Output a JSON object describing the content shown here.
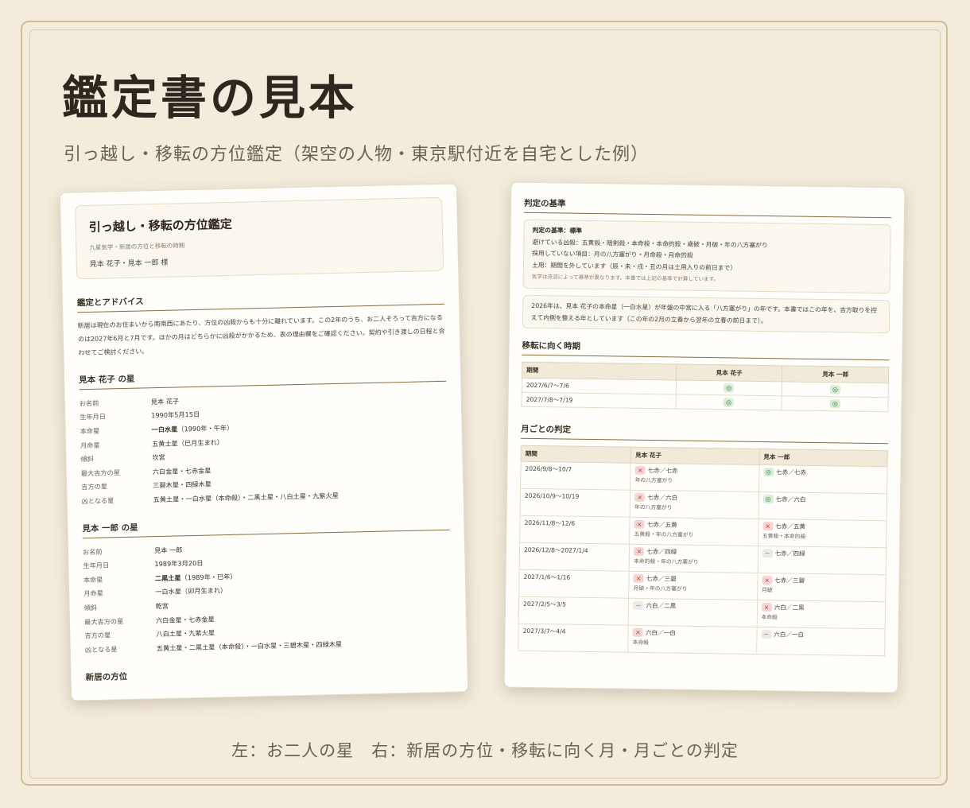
{
  "header": {
    "title": "鑑定書の見本",
    "subtitle": "引っ越し・移転の方位鑑定（架空の人物・東京駅付近を自宅とした例）"
  },
  "caption": "左：お二人の星　右：新居の方位・移転に向く月・月ごとの判定",
  "left_page": {
    "title": "引っ越し・移転の方位鑑定",
    "subtitle": "九星気学・新居の方位と移転の時期",
    "names": "見本 花子・見本 一郎 様",
    "advice_heading": "鑑定とアドバイス",
    "advice_text": "新居は現在のお住まいから南南西にあたり、方位の凶殺からも十分に離れています。この2年のうち、お二人そろって吉方になるのは2027年6月と7月です。ほかの月はどちらかに凶殺がかかるため、表の理由欄をご確認ください。契約や引き渡しの日程と合わせてご検討ください。",
    "hanako": {
      "heading": "見本 花子 の星",
      "rows": [
        {
          "label": "お名前",
          "value": "見本 花子"
        },
        {
          "label": "生年月日",
          "value": "1990年5月15日"
        },
        {
          "label": "本命星",
          "value": "一白水星",
          "extra": "（1990年・午年）"
        },
        {
          "label": "月命星",
          "value": "五黄土星（巳月生まれ）"
        },
        {
          "label": "傾斜",
          "value": "坎宮"
        },
        {
          "label": "最大吉方の星",
          "value": "六白金星・七赤金星"
        },
        {
          "label": "吉方の星",
          "value": "三碧木星・四緑木星"
        },
        {
          "label": "凶となる星",
          "value": "五黄土星・一白水星（本命殺）・二黒土星・八白土星・九紫火星"
        }
      ]
    },
    "ichiro": {
      "heading": "見本 一郎 の星",
      "rows": [
        {
          "label": "お名前",
          "value": "見本 一郎"
        },
        {
          "label": "生年月日",
          "value": "1989年3月20日"
        },
        {
          "label": "本命星",
          "value": "二黒土星",
          "extra": "（1989年・巳年）"
        },
        {
          "label": "月命星",
          "value": "一白水星（卯月生まれ）"
        },
        {
          "label": "傾斜",
          "value": "乾宮"
        },
        {
          "label": "最大吉方の星",
          "value": "六白金星・七赤金星"
        },
        {
          "label": "吉方の星",
          "value": "八白土星・九紫火星"
        },
        {
          "label": "凶となる星",
          "value": "五黄土星・二黒土星（本命殺）・一白水星・三碧木星・四緑木星"
        }
      ]
    },
    "next_heading": "新居の方位"
  },
  "right_page": {
    "basis_heading": "判定の基準",
    "basis_title": "判定の基準：標準",
    "basis_lines": [
      "避けている凶殺：五黄殺・暗剣殺・本命殺・本命的殺・歳破・月破・年の八方塞がり",
      "採用していない項目：月の八方塞がり・月命殺・月命的殺",
      "土用：期間を外しています（辰・未・戌・丑の月は土用入りの前日まで）"
    ],
    "basis_note": "気学は流派によって基準が異なります。本書では上記の基準で計算しています。",
    "year_note": "2026年は、見本 花子の本命星（一白水星）が年盤の中宮に入る「八方塞がり」の年です。本書ではこの年を、吉方取りを控えて内側を整える年としています（この年の2月の立春から翌年の立春の前日まで）。",
    "timing_heading": "移転に向く時期",
    "timing_headers": [
      "期間",
      "見本 花子",
      "見本 一郎"
    ],
    "timing_rows": [
      {
        "period": "2027/6/7〜7/6",
        "a": "◎",
        "b": "◎"
      },
      {
        "period": "2027/7/8〜7/19",
        "a": "◎",
        "b": "◎"
      }
    ],
    "monthly_heading": "月ごとの判定",
    "monthly_headers": [
      "期間",
      "見本 花子",
      "見本 一郎"
    ],
    "monthly_rows": [
      {
        "period": "2026/9/8〜10/7",
        "a_mark": "×",
        "a_stars": "七赤／七赤",
        "a_note": "年の八方塞がり",
        "b_mark": "◎",
        "b_stars": "七赤／七赤",
        "b_note": ""
      },
      {
        "period": "2026/10/9〜10/19",
        "a_mark": "×",
        "a_stars": "七赤／六白",
        "a_note": "年の八方塞がり",
        "b_mark": "◎",
        "b_stars": "七赤／六白",
        "b_note": ""
      },
      {
        "period": "2026/11/8〜12/6",
        "a_mark": "×",
        "a_stars": "七赤／五黄",
        "a_note": "五黄殺・年の八方塞がり",
        "b_mark": "×",
        "b_stars": "七赤／五黄",
        "b_note": "五黄殺・本命的殺"
      },
      {
        "period": "2026/12/8〜2027/1/4",
        "a_mark": "×",
        "a_stars": "七赤／四緑",
        "a_note": "本命的殺・年の八方塞がり",
        "b_mark": "−",
        "b_stars": "七赤／四緑",
        "b_note": ""
      },
      {
        "period": "2027/1/6〜1/16",
        "a_mark": "×",
        "a_stars": "七赤／三碧",
        "a_note": "月破・年の八方塞がり",
        "b_mark": "×",
        "b_stars": "七赤／三碧",
        "b_note": "月破"
      },
      {
        "period": "2027/2/5〜3/5",
        "a_mark": "−",
        "a_stars": "六白／二黒",
        "a_note": "",
        "b_mark": "×",
        "b_stars": "六白／二黒",
        "b_note": "本命殺"
      },
      {
        "period": "2027/3/7〜4/4",
        "a_mark": "×",
        "a_stars": "六白／一白",
        "a_note": "本命殺",
        "b_mark": "−",
        "b_stars": "六白／一白",
        "b_note": ""
      }
    ]
  }
}
